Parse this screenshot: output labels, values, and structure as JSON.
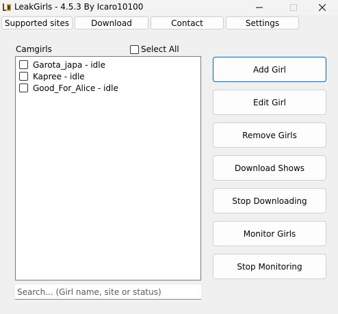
{
  "window": {
    "title": "LeakGirls - 4.5.3 By Icaro10100"
  },
  "tabs": [
    {
      "label": "Supported sites"
    },
    {
      "label": "Download"
    },
    {
      "label": "Contact"
    },
    {
      "label": "Settings"
    }
  ],
  "list": {
    "label": "Camgirls",
    "select_all_label": "Select All",
    "items": [
      {
        "label": "Garota_japa - idle",
        "checked": false
      },
      {
        "label": "Kapree - idle",
        "checked": false
      },
      {
        "label": "Good_For_Alice - idle",
        "checked": false
      }
    ]
  },
  "search": {
    "placeholder": "Search... (Girl name, site or status)",
    "value": ""
  },
  "actions": [
    {
      "label": "Add Girl"
    },
    {
      "label": "Edit Girl"
    },
    {
      "label": "Remove Girls"
    },
    {
      "label": "Download Shows"
    },
    {
      "label": "Stop Downloading"
    },
    {
      "label": "Monitor Girls"
    },
    {
      "label": "Stop Monitoring"
    }
  ],
  "colors": {
    "background": "#f0f0f0",
    "focus_border": "#0067c0",
    "button_bg": "#fdfdfd"
  }
}
